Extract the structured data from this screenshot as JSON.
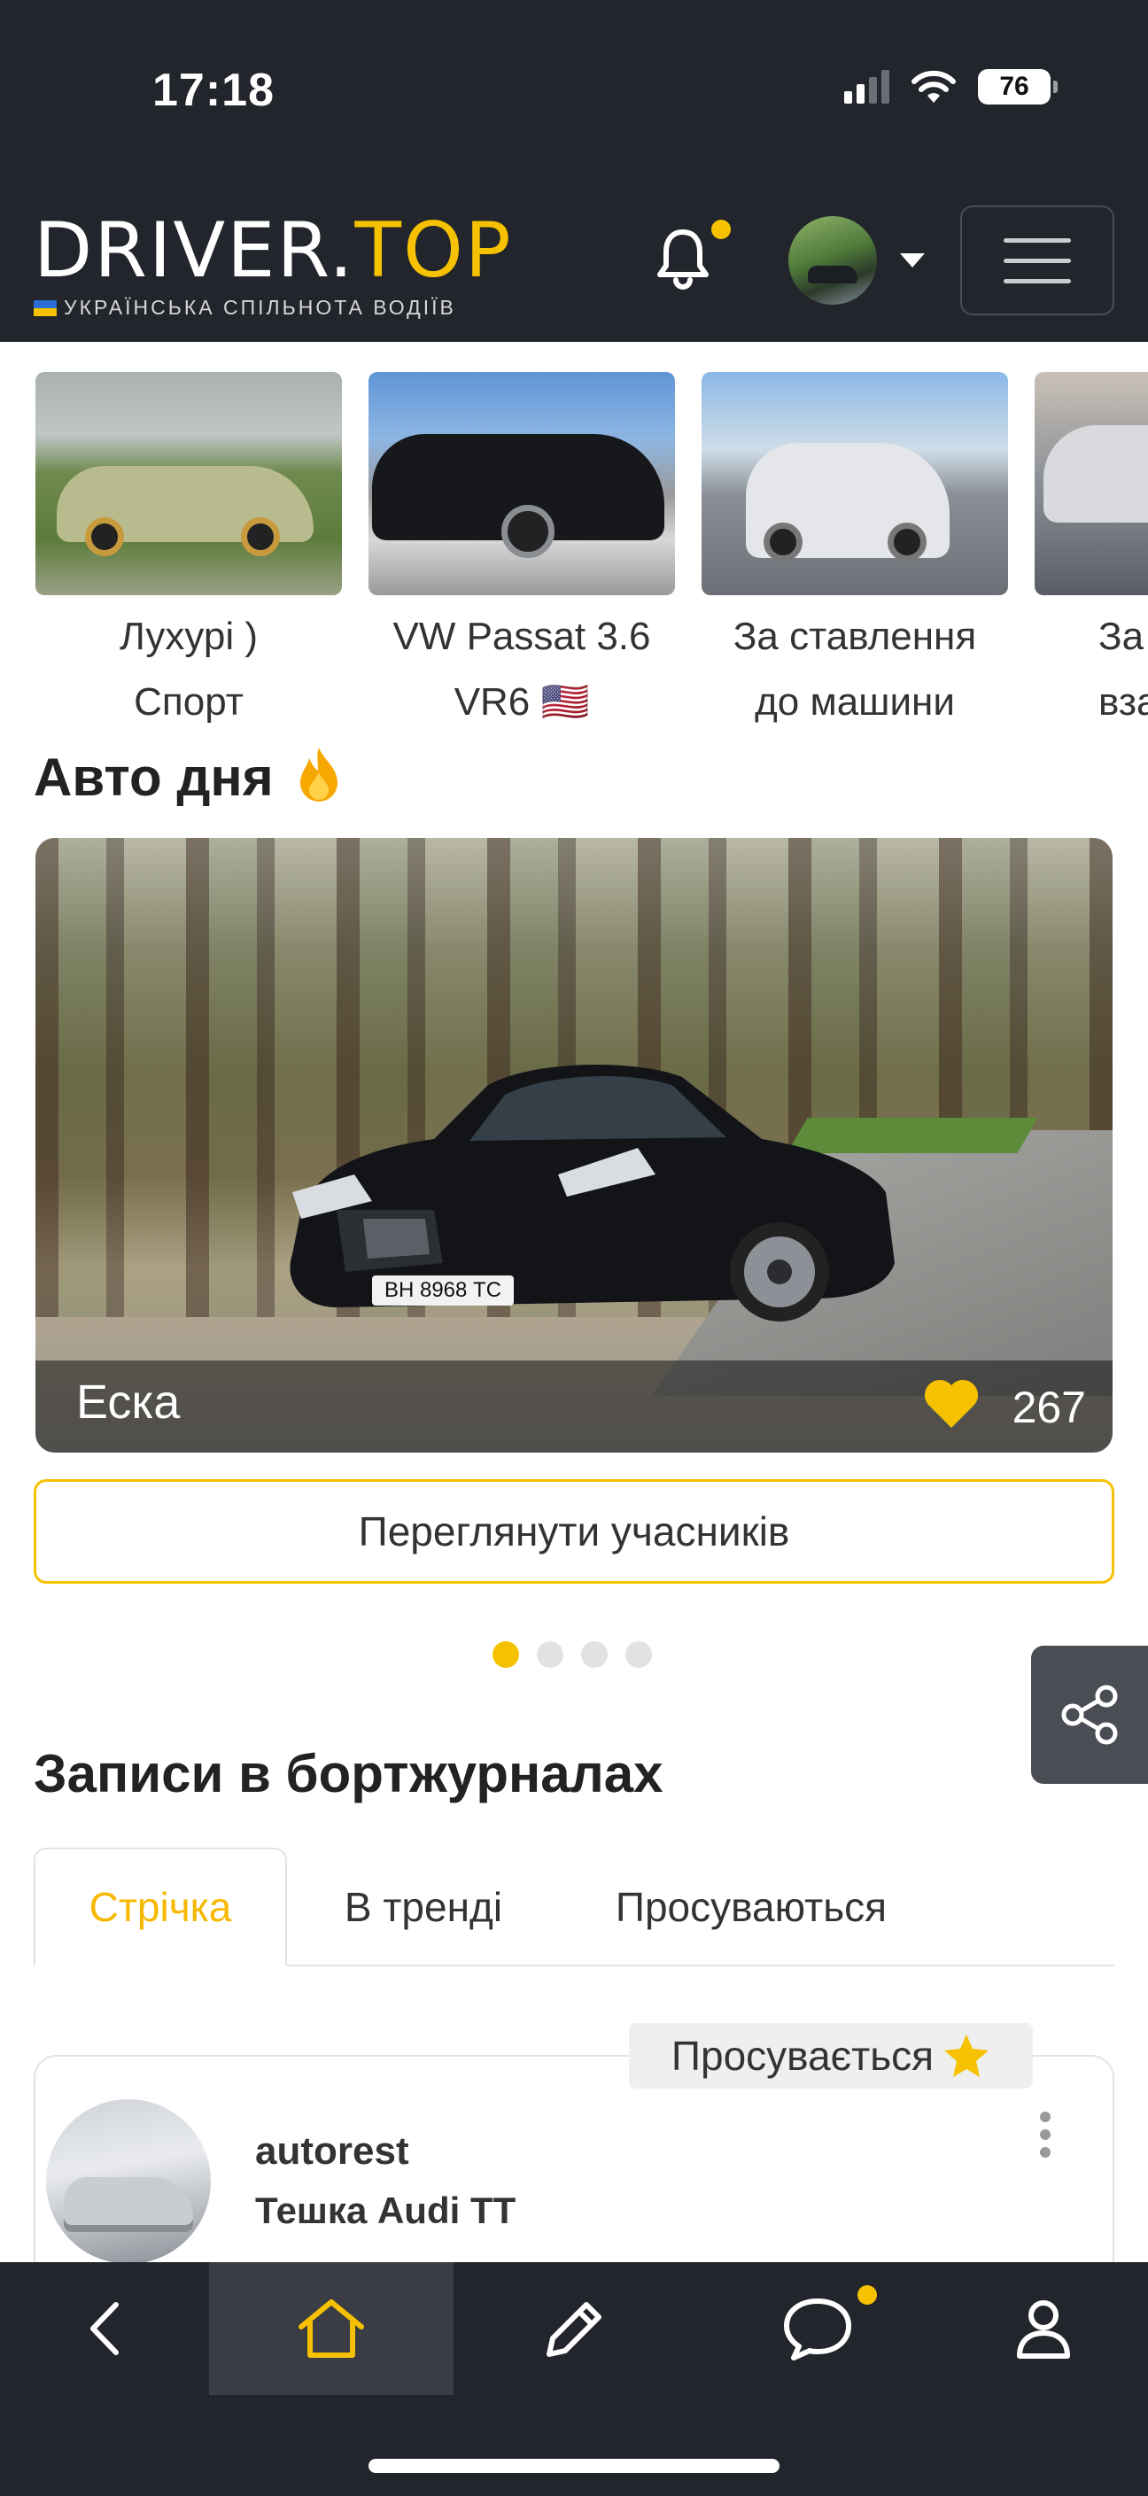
{
  "status_bar": {
    "time": "17:18",
    "battery": "76",
    "icons": [
      "signal-icon",
      "wifi-icon",
      "battery-icon"
    ]
  },
  "header": {
    "logo_main": "DRIVER.",
    "logo_accent": "TOP",
    "tagline": "УКРАЇНСЬКА СПІЛЬНОТА ВОДІЇВ",
    "icons": [
      "bell-icon",
      "avatar",
      "chevron-down-icon",
      "hamburger-menu-icon"
    ],
    "has_notification": true
  },
  "stories": [
    {
      "caption_line1": "Лухурі )",
      "caption_line2": "Спорт"
    },
    {
      "caption_line1": "VW Passat 3.6",
      "caption_line2": "VR6 🇺🇸"
    },
    {
      "caption_line1": "За ставлення",
      "caption_line2": "до машини"
    },
    {
      "caption_line1": "За",
      "caption_line2": "вза"
    }
  ],
  "car_of_day": {
    "title": "Авто дня",
    "car_name": "Еска",
    "likes": "267",
    "plate": "ВН 8968 ТС",
    "view_button": "Переглянути учасників",
    "carousel_pages": 4,
    "carousel_active": 1
  },
  "logbooks": {
    "title": "Записи в бортжурналах",
    "tabs": [
      {
        "label": "Стрічка",
        "active": true
      },
      {
        "label": "В тренді",
        "active": false
      },
      {
        "label": "Просуваються",
        "active": false
      }
    ]
  },
  "post": {
    "badge": "Просувається",
    "username": "autorest",
    "title": "Тешка Audi TT"
  },
  "bottom_nav": {
    "items": [
      "back-icon",
      "home-icon",
      "pencil-icon",
      "chat-icon",
      "profile-icon"
    ],
    "active": "home-icon"
  },
  "colors": {
    "accent": "#f6c100",
    "dark": "#22252b"
  }
}
